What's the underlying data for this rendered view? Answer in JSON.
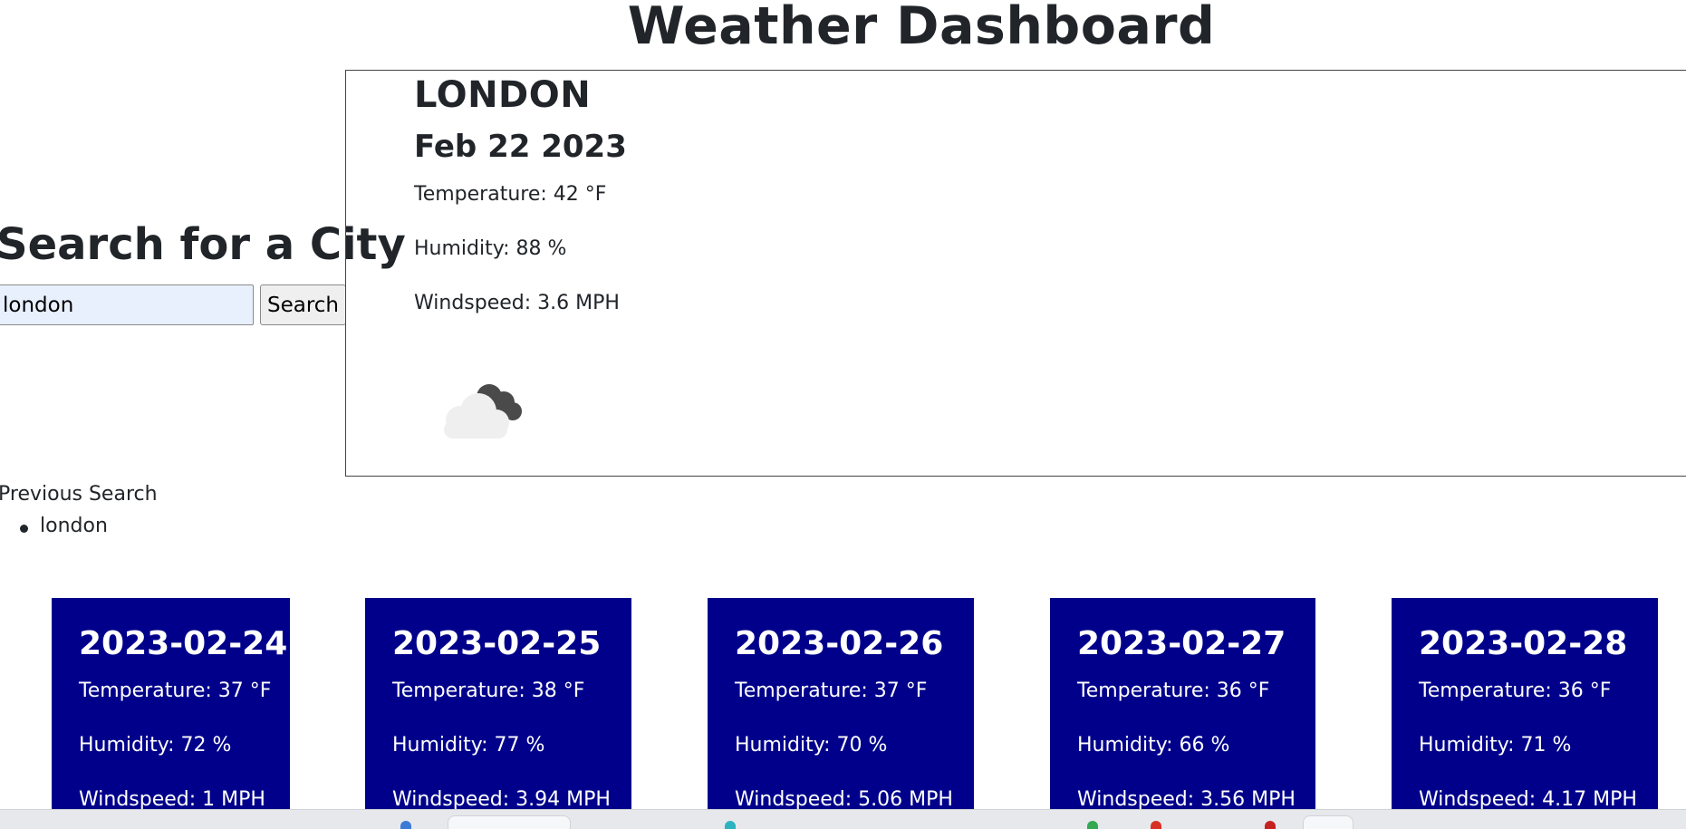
{
  "header": {
    "title": "Weather Dashboard"
  },
  "search": {
    "heading": "Search for a City",
    "input_value": "london",
    "button_label": "Search"
  },
  "current": {
    "city": "LONDON",
    "date": "Feb 22 2023",
    "temperature": "Temperature: 42 °F",
    "humidity": "Humidity: 88 %",
    "windspeed": "Windspeed: 3.6 MPH",
    "icon": "cloudy-night-icon"
  },
  "history": {
    "label": "Previous Search",
    "items": [
      "london"
    ]
  },
  "forecast": [
    {
      "date": "2023-02-24",
      "temperature": "Temperature: 37 °F",
      "humidity": "Humidity: 72 %",
      "windspeed": "Windspeed: 1 MPH"
    },
    {
      "date": "2023-02-25",
      "temperature": "Temperature: 38 °F",
      "humidity": "Humidity: 77 %",
      "windspeed": "Windspeed: 3.94 MPH"
    },
    {
      "date": "2023-02-26",
      "temperature": "Temperature: 37 °F",
      "humidity": "Humidity: 70 %",
      "windspeed": "Windspeed: 5.06 MPH"
    },
    {
      "date": "2023-02-27",
      "temperature": "Temperature: 36 °F",
      "humidity": "Humidity: 66 %",
      "windspeed": "Windspeed: 3.56 MPH"
    },
    {
      "date": "2023-02-28",
      "temperature": "Temperature: 36 °F",
      "humidity": "Humidity: 71 %",
      "windspeed": "Windspeed: 4.17 MPH"
    }
  ],
  "colors": {
    "forecast_card_bg": "#00008b",
    "forecast_card_text": "#ffffff",
    "input_bg": "#e8f0fe"
  }
}
